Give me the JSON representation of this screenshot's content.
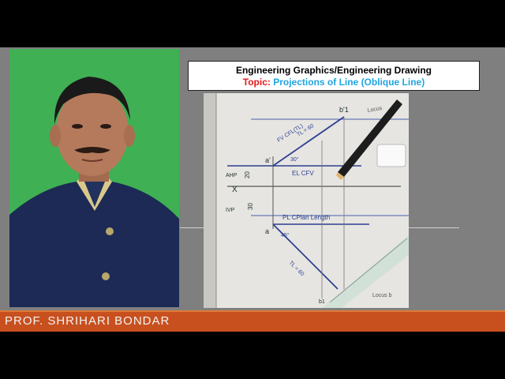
{
  "title_box": {
    "line1": "Engineering Graphics/Engineering Drawing",
    "topic_prefix": "Topic:",
    "topic_text": "Projections of Line (Oblique Line)"
  },
  "drawing_labels": {
    "b1_prime": "b'1",
    "a_prime": "a'",
    "fv_label": "FV CFL(TL)",
    "tl_value": "TL = 60",
    "angle30": "30°",
    "el_label": "EL CFV",
    "ahp": "AHP",
    "dim20": "20",
    "x": "X",
    "ivp": "IVP",
    "dim30": "30",
    "pl_label": "PL CPlan Length",
    "a": "a",
    "angle45": "45°",
    "b1": "b1",
    "tl_plan": "TL = 60",
    "locus": "Locus",
    "locus_b": "Locus b"
  },
  "name_bar": {
    "name": "PROF. SHRIHARI BONDAR"
  },
  "colors": {
    "name_bar": "#c8501e",
    "topic_prefix": "#e01b1b",
    "topic_text": "#1fa5e0",
    "green_screen": "#3fb054",
    "frame": "#7f7f7f"
  }
}
